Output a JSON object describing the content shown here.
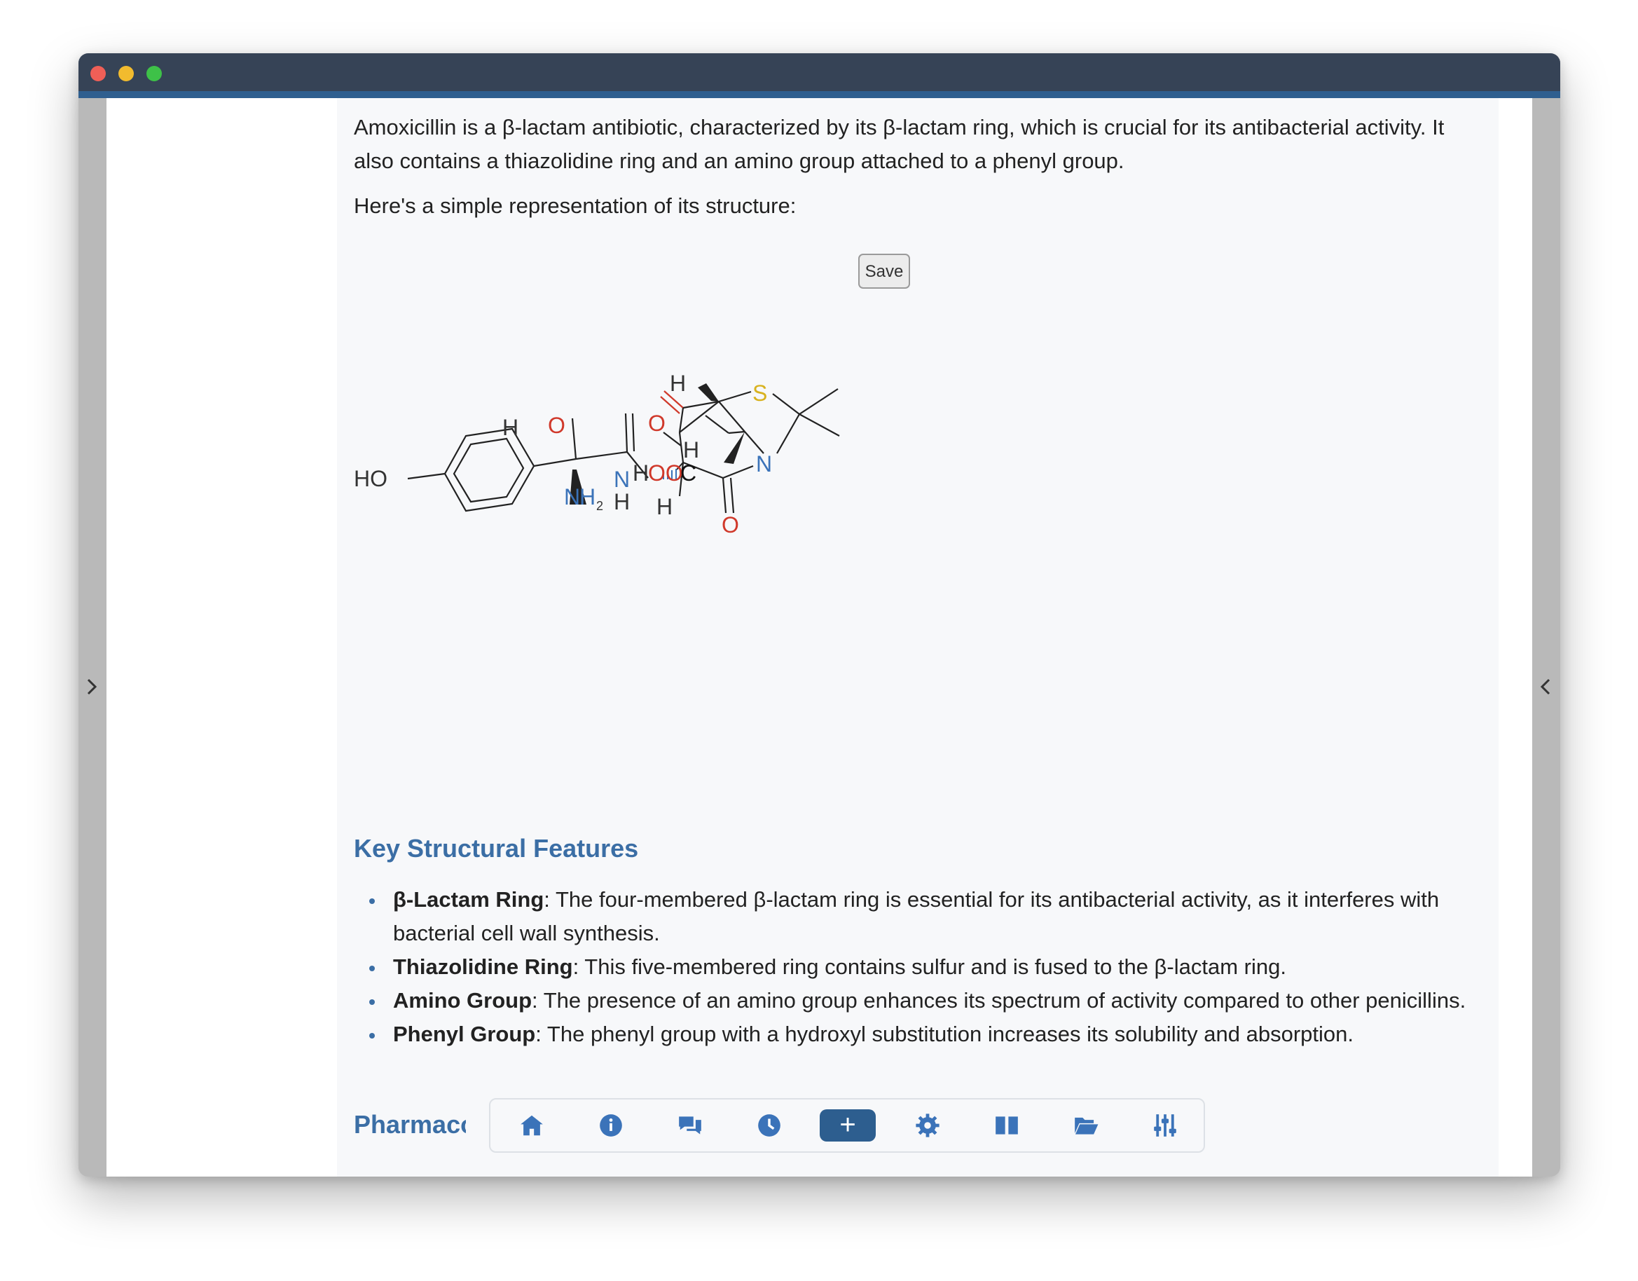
{
  "intro": {
    "line1": "Amoxicillin is a β-lactam antibiotic, characterized by its β-lactam ring, which is crucial for its antibacterial activity. It",
    "line2": "also contains a thiazolidine ring and an amino group attached to a phenyl group.",
    "line3": "Here's a simple representation of its structure:"
  },
  "save_label": "Save",
  "molecule": {
    "HO": "HO",
    "H": "H",
    "O": "O",
    "N": "N",
    "NH2_N": "N",
    "NH2_H": "H",
    "NH2_sub": "2",
    "S": "S",
    "HOOC_H": "H",
    "HOOC_OO": "OO",
    "HOOC_C": "C"
  },
  "section_title": "Key Structural Features",
  "features": [
    {
      "term": "β-Lactam Ring",
      "text": ": The four-membered β-lactam ring is essential for its antibacterial activity, as it interferes with bacterial cell wall synthesis."
    },
    {
      "term": "Thiazolidine Ring",
      "text": ": This five-membered ring contains sulfur and is fused to the β-lactam ring."
    },
    {
      "term": "Amino Group",
      "text": ": The presence of an amino group enhances its spectrum of activity compared to other penicillins."
    },
    {
      "term": "Phenyl Group",
      "text": ": The phenyl group with a hydroxyl substitution increases its solubility and absorption."
    }
  ],
  "next_section_title": "Pharmacokinetics",
  "toolbar": {
    "icons": [
      "home-icon",
      "info-icon",
      "chat-icon",
      "history-icon",
      "add-icon",
      "settings-icon",
      "book-icon",
      "folder-icon",
      "sliders-icon"
    ],
    "plus_label": "+"
  },
  "colors": {
    "accent": "#3b6ea5",
    "titlebar": "#364356",
    "button": "#2d5e8f"
  }
}
